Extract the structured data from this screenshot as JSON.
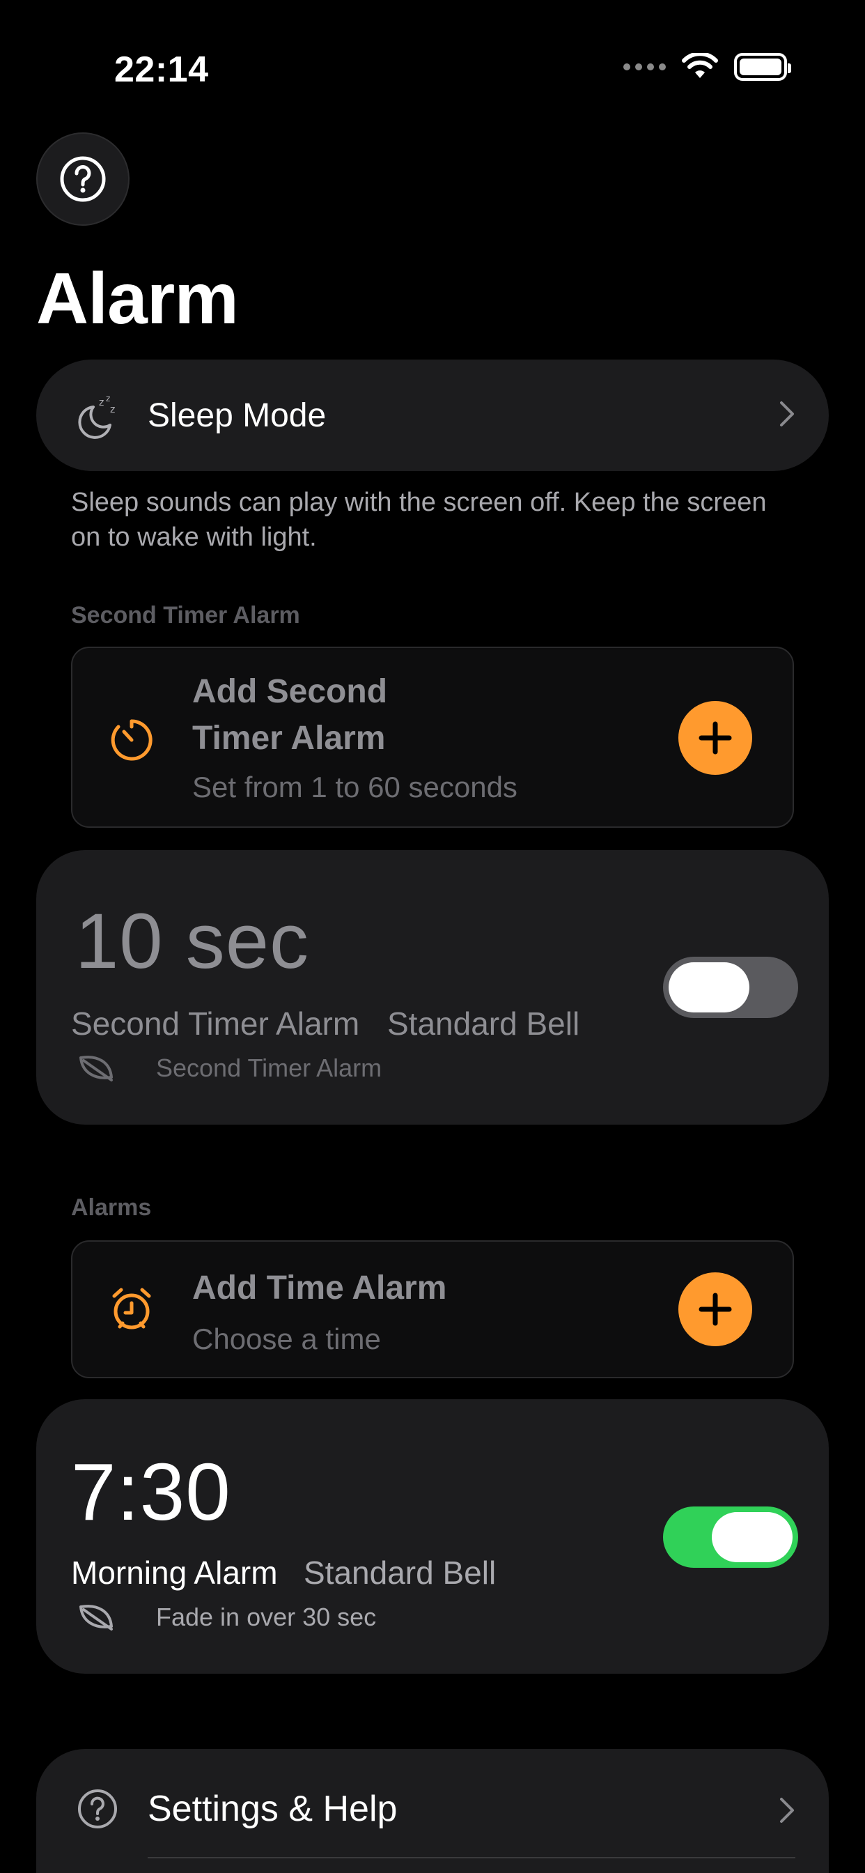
{
  "status_bar": {
    "time": "22:14"
  },
  "header": {
    "title": "Alarm"
  },
  "sleep_mode": {
    "label": "Sleep Mode",
    "note": "Sleep sounds can play with the screen off. Keep the screen on to wake with light."
  },
  "second_timer_section": {
    "label": "Second Timer Alarm",
    "add_card": {
      "title_line1": "Add Second",
      "title_line2": "Timer Alarm",
      "subtitle": "Set from 1 to 60 seconds"
    },
    "alarm": {
      "time": "10 sec",
      "name": "Second Timer Alarm",
      "sound": "Standard Bell",
      "detail": "Second Timer Alarm",
      "enabled": false
    }
  },
  "alarms_section": {
    "label": "Alarms",
    "add_card": {
      "title": "Add Time Alarm",
      "subtitle": "Choose a time"
    },
    "alarm": {
      "time": "7:30",
      "name": "Morning Alarm",
      "sound": "Standard Bell",
      "detail": "Fade in over 30 sec",
      "enabled": true
    }
  },
  "settings": {
    "label": "Settings & Help"
  },
  "colors": {
    "accent_orange": "#ff9a2e",
    "toggle_on": "#30d158",
    "toggle_off": "#5a5a5e",
    "card_bg": "#1c1c1e"
  }
}
